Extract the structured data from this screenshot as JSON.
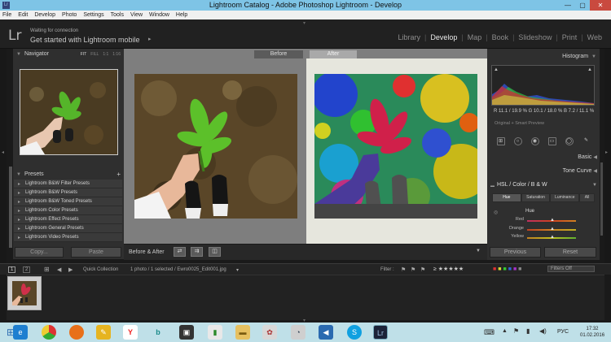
{
  "window": {
    "title": "Lightroom Catalog - Adobe Photoshop Lightroom - Develop"
  },
  "menu": [
    "File",
    "Edit",
    "Develop",
    "Photo",
    "Settings",
    "Tools",
    "View",
    "Window",
    "Help"
  ],
  "identity": {
    "logo": "Lr",
    "status": "Waiting for connection",
    "message": "Get started with Lightroom mobile"
  },
  "modules": [
    "Library",
    "Develop",
    "Map",
    "Book",
    "Slideshow",
    "Print",
    "Web"
  ],
  "active_module": "Develop",
  "navigator": {
    "title": "Navigator",
    "zoom_options": [
      "FIT",
      "FILL",
      "1:1",
      "1:16"
    ]
  },
  "presets": {
    "title": "Presets",
    "add_icon": "+",
    "items": [
      "Lightroom B&W Filter Presets",
      "Lightroom B&W Presets",
      "Lightroom B&W Toned Presets",
      "Lightroom Color Presets",
      "Lightroom Effect Presets",
      "Lightroom General Presets",
      "Lightroom Video Presets"
    ]
  },
  "left_buttons": {
    "copy": "Copy...",
    "paste": "Paste"
  },
  "compare": {
    "before_label": "Before",
    "after_label": "After",
    "mode_label": "Before & After"
  },
  "histogram": {
    "title": "Histogram",
    "values": "R  11.1 / 19.9  %   G  10.1 / 18.0  %   B  7.2 / 11.1  %",
    "preview": "Original + Smart Preview"
  },
  "right_sections": [
    "Basic",
    "Tone Curve"
  ],
  "hsl": {
    "header": "HSL  /  Color  /  B & W",
    "tabs": [
      "Hue",
      "Saturation",
      "Luminance",
      "All"
    ],
    "sub": "Hue",
    "sliders": [
      "Red",
      "Orange",
      "Yellow"
    ]
  },
  "right_buttons": {
    "previous": "Previous",
    "reset": "Reset"
  },
  "filmstrip": {
    "source": "Quick Collection",
    "info": "1 photo / 1 selected / Ewro0025_Edit001.jpg",
    "filter_label": "Filter :",
    "filters_off": "Filters Off"
  },
  "colors": {
    "lightroom_dark": "#2f2f2f",
    "titlebar": "#7ec4e6",
    "taskbar": "#bfe0e8"
  },
  "taskbar": {
    "icons": [
      "windows-start-icon",
      "ie-icon",
      "chrome-icon",
      "firefox-icon",
      "paint-icon",
      "yandex-icon",
      "bing-icon",
      "app-icon",
      "chart-icon",
      "folder-icon",
      "photo-icon",
      "paint-alt-icon",
      "volume-icon",
      "skype-icon",
      "lightroom-icon"
    ],
    "lang": "РУС",
    "time": "17:32",
    "date": "01.02.2016"
  }
}
